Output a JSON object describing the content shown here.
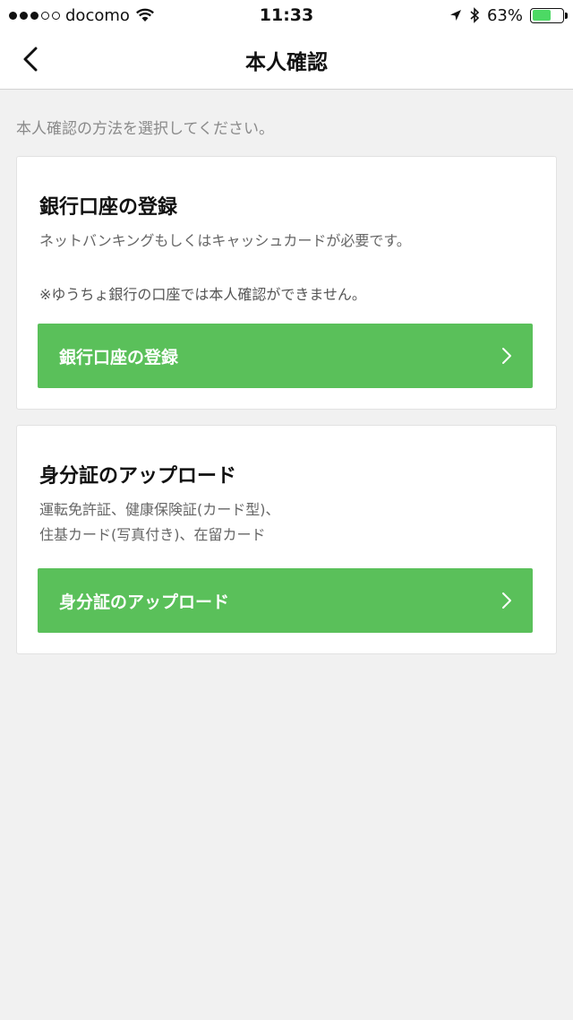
{
  "status_bar": {
    "carrier": "docomo",
    "time": "11:33",
    "battery_percent": "63%",
    "battery_level": 0.63,
    "icons": [
      "signal-dots-icon",
      "wifi-icon",
      "location-arrow-icon",
      "bluetooth-icon",
      "battery-icon"
    ]
  },
  "nav": {
    "title": "本人確認",
    "back_icon": "chevron-left-icon"
  },
  "instruction": "本人確認の方法を選択してください。",
  "cards": [
    {
      "title": "銀行口座の登録",
      "description": "ネットバンキングもしくはキャッシュカードが必要です。",
      "note": "※ゆうちょ銀行の口座では本人確認ができません。",
      "button_label": "銀行口座の登録"
    },
    {
      "title": "身分証のアップロード",
      "description_line1": "運転免許証、健康保険証(カード型)、",
      "description_line2": "住基カード(写真付き)、在留カード",
      "button_label": "身分証のアップロード"
    }
  ],
  "colors": {
    "accent_green": "#5ac05a",
    "background": "#f1f1f1",
    "battery_green": "#4cd964"
  }
}
